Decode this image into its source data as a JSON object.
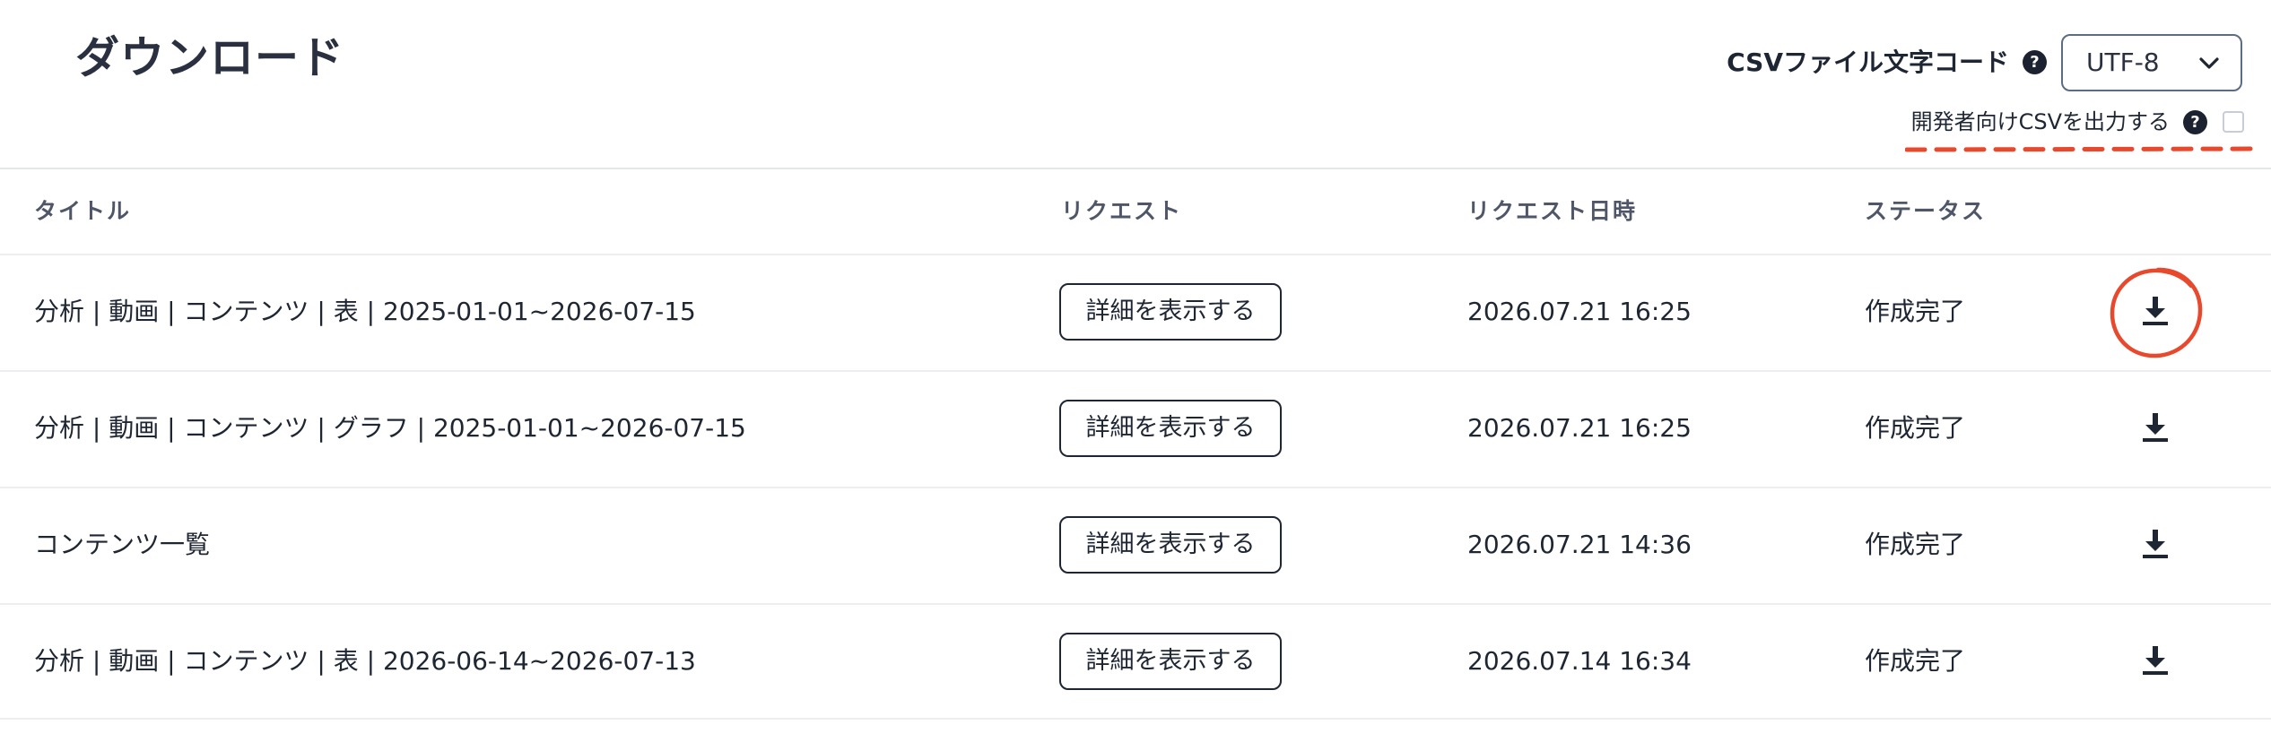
{
  "header": {
    "title": "ダウンロード",
    "encoding_label": "CSVファイル文字コード",
    "encoding_value": "UTF-8",
    "dev_csv_label": "開発者向けCSVを出力する",
    "help_glyph": "?",
    "dev_csv_checked": false
  },
  "table": {
    "columns": [
      "タイトル",
      "リクエスト",
      "リクエスト日時",
      "ステータス"
    ],
    "rows": [
      {
        "title": "分析 | 動画 | コンテンツ | 表 | 2025-01-01~2026-07-15",
        "button": "詳細を表示する",
        "date": "2026.07.21 16:25",
        "status": "作成完了"
      },
      {
        "title": "分析 | 動画 | コンテンツ | グラフ | 2025-01-01~2026-07-15",
        "button": "詳細を表示する",
        "date": "2026.07.21 16:25",
        "status": "作成完了"
      },
      {
        "title": "コンテンツ一覧",
        "button": "詳細を表示する",
        "date": "2026.07.21 14:36",
        "status": "作成完了"
      },
      {
        "title": "分析 | 動画 | コンテンツ | 表 | 2026-06-14~2026-07-13",
        "button": "詳細を表示する",
        "date": "2026.07.14 16:34",
        "status": "作成完了"
      }
    ]
  },
  "icons": {
    "help": "question-circle-icon",
    "select": "chevron-down-icon",
    "row_action": "download-icon"
  },
  "annotations": {
    "color": "#e8482c"
  },
  "colors": {
    "text": "#1f2633",
    "header_text": "#4e5668",
    "select_border": "#5d6b85"
  }
}
